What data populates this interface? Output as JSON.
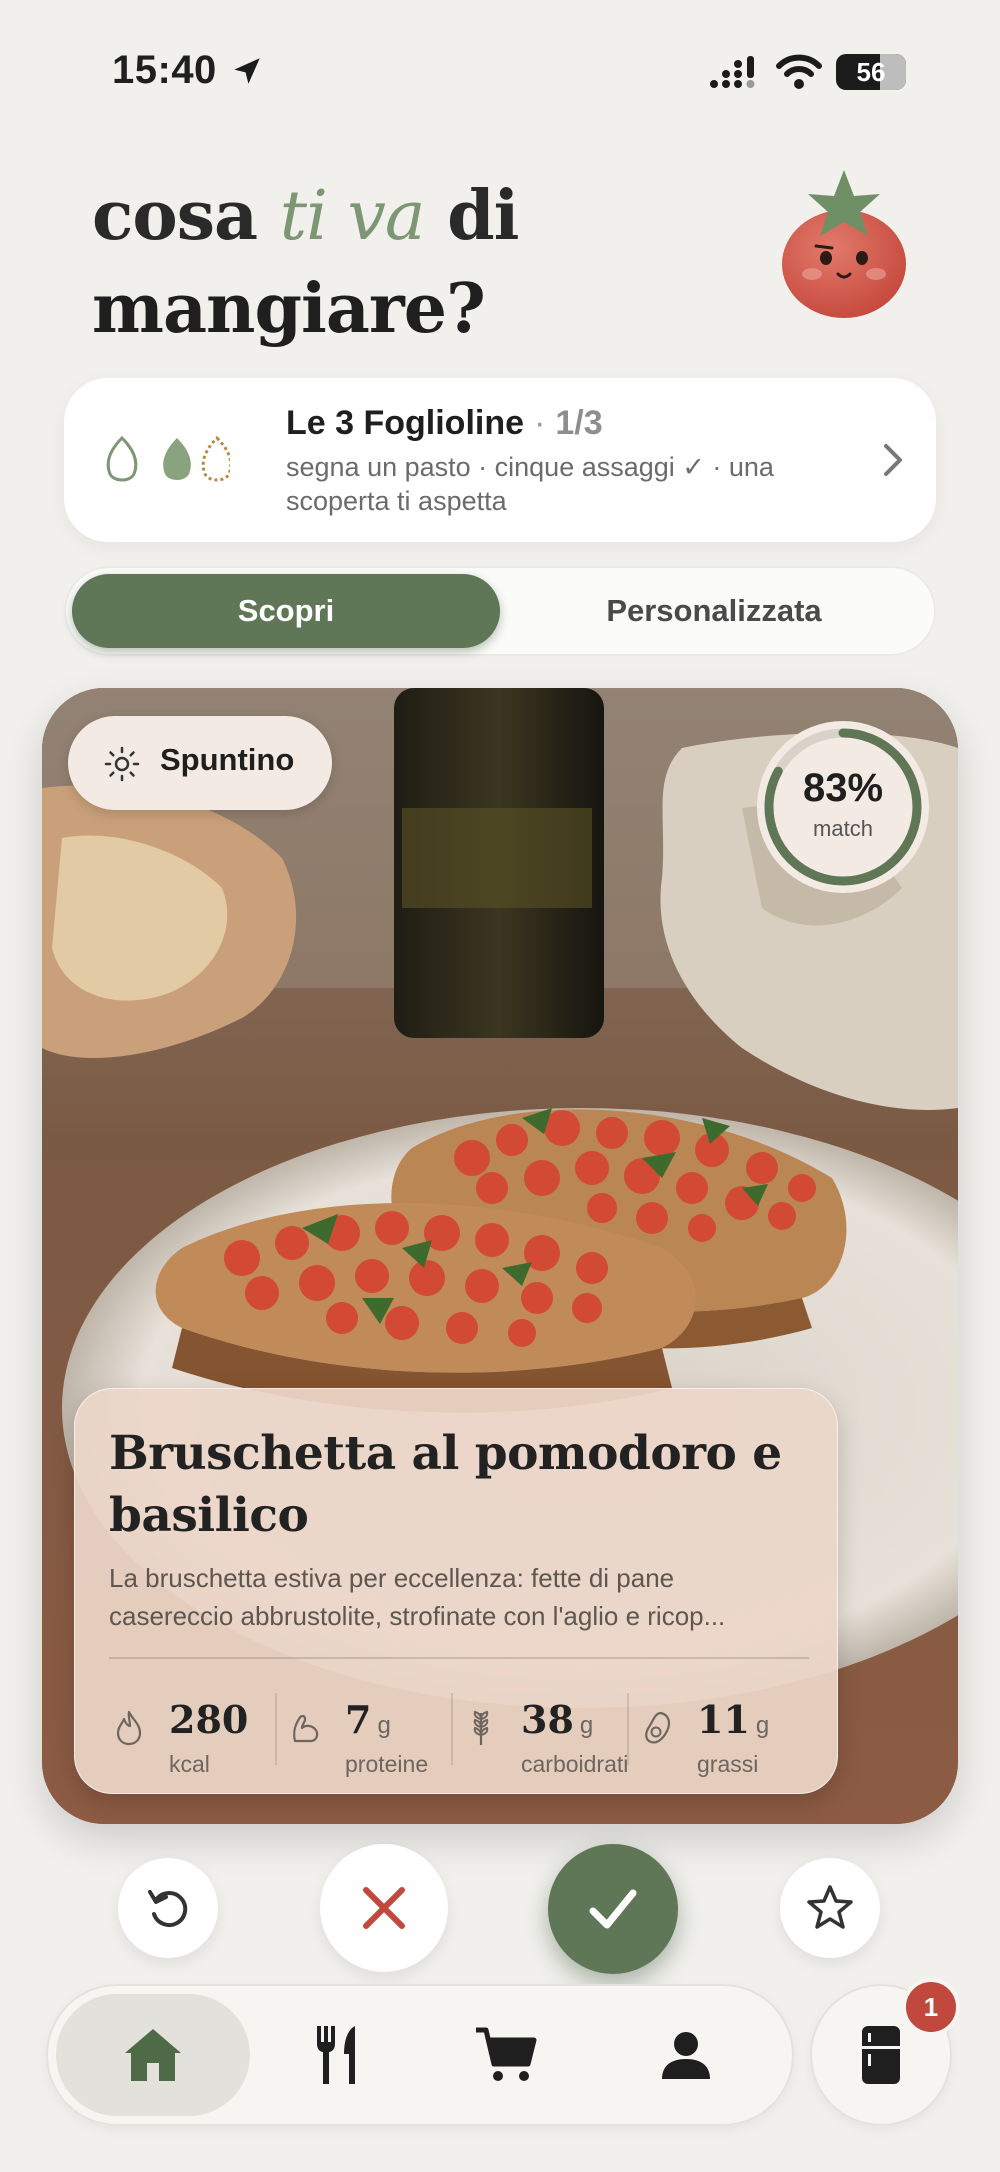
{
  "status_bar": {
    "time": "15:40",
    "battery": "56",
    "icons": [
      "location-arrow-icon",
      "cellular-signal-icon",
      "wifi-icon",
      "battery-icon"
    ]
  },
  "header": {
    "title_part1": "cosa ",
    "title_accent": "ti va",
    "title_part2": " di",
    "title_line2": "mangiare?",
    "mascot": "tomato-mascot"
  },
  "challenge": {
    "title": "Le 3 Foglioline",
    "separator": "·",
    "progress": "1/3",
    "description": "segna un pasto · cinque assaggi ✓ · una scoperta ti aspetta",
    "completed_leaves": 1,
    "total_leaves": 3
  },
  "tabs": {
    "active": "Scopri",
    "inactive": "Personalizzata"
  },
  "recipe": {
    "meal_type": "Spuntino",
    "match_percent": "83%",
    "match_fraction": 0.83,
    "match_label": "match",
    "title": "Bruschetta al pomodoro e basilico",
    "description_line1": "La bruschetta estiva per eccellenza: fette di pane",
    "description_line2": "casereccio abbrustolite, strofinate con l'aglio e ricop...",
    "macros": [
      {
        "value": "280",
        "unit": "",
        "name": "kcal",
        "icon": "flame-icon"
      },
      {
        "value": "7",
        "unit": "g",
        "name": "proteine",
        "icon": "muscle-icon"
      },
      {
        "value": "38",
        "unit": "g",
        "name": "carboidrati",
        "icon": "wheat-icon"
      },
      {
        "value": "11",
        "unit": "g",
        "name": "grassi",
        "icon": "avocado-icon"
      }
    ]
  },
  "nav": {
    "items": [
      "home-icon",
      "fork-knife-icon",
      "cart-icon",
      "profile-icon"
    ],
    "fridge_badge": "1"
  },
  "colors": {
    "accent_green": "#5f7657",
    "accent_red": "#c0483c",
    "background": "#f1f0ed"
  }
}
